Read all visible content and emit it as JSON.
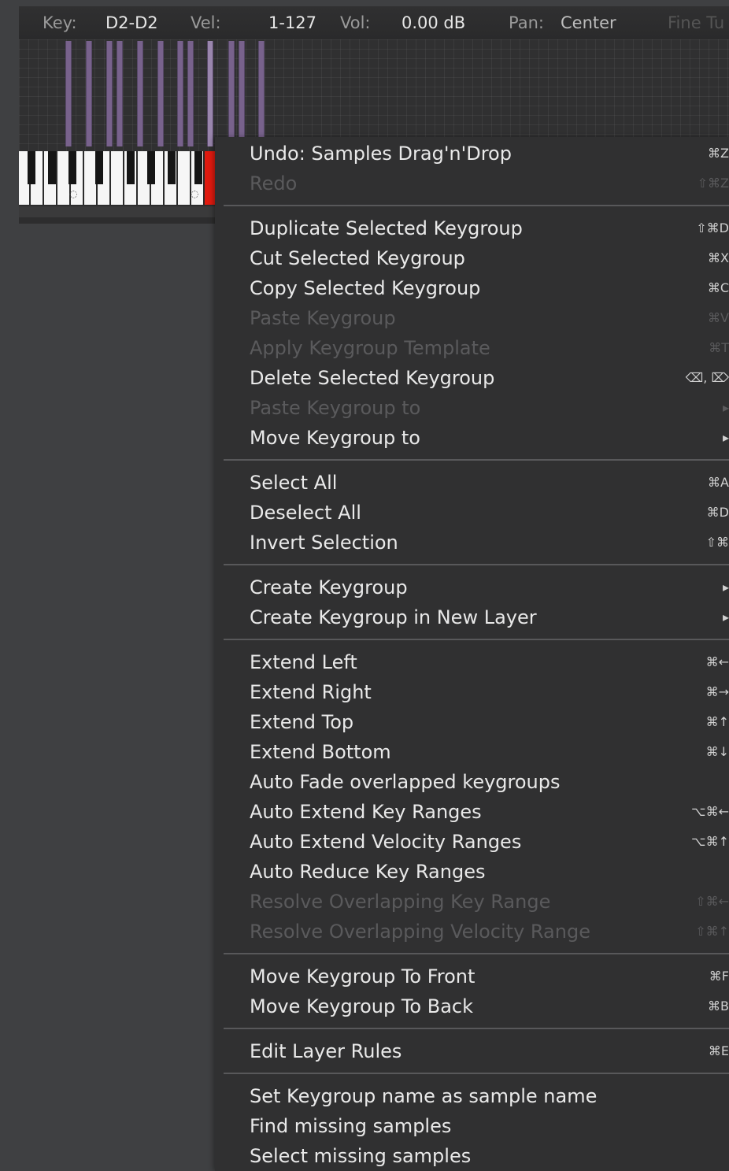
{
  "infobar": {
    "key_label": "Key:",
    "key_value": "D2-D2",
    "vel_label": "Vel:",
    "vel_value": "1-127",
    "vol_label": "Vol:",
    "vol_value": "0.00 dB",
    "pan_label": "Pan:",
    "pan_value": "Center",
    "fine_tune_label": "Fine Tu"
  },
  "menu": {
    "groups": [
      [
        {
          "label": "Undo: Samples Drag'n'Drop",
          "shortcut": "⌘Z",
          "enabled": true
        },
        {
          "label": "Redo",
          "shortcut": "⇧⌘Z",
          "enabled": false
        }
      ],
      [
        {
          "label": "Duplicate Selected Keygroup",
          "shortcut": "⇧⌘D",
          "enabled": true
        },
        {
          "label": "Cut Selected Keygroup",
          "shortcut": "⌘X",
          "enabled": true
        },
        {
          "label": "Copy Selected Keygroup",
          "shortcut": "⌘C",
          "enabled": true
        },
        {
          "label": "Paste Keygroup",
          "shortcut": "⌘V",
          "enabled": false
        },
        {
          "label": "Apply Keygroup Template",
          "shortcut": "⌘T",
          "enabled": false
        },
        {
          "label": "Delete Selected Keygroup",
          "shortcut": "⌫, ⌦",
          "enabled": true
        },
        {
          "label": "Paste Keygroup to",
          "shortcut": "▸",
          "enabled": false
        },
        {
          "label": "Move Keygroup to",
          "shortcut": "▸",
          "enabled": true
        }
      ],
      [
        {
          "label": "Select All",
          "shortcut": "⌘A",
          "enabled": true
        },
        {
          "label": "Deselect All",
          "shortcut": "⌘D",
          "enabled": true
        },
        {
          "label": "Invert Selection",
          "shortcut": "⇧⌘",
          "enabled": true
        }
      ],
      [
        {
          "label": "Create Keygroup",
          "shortcut": "▸",
          "enabled": true
        },
        {
          "label": "Create Keygroup in New Layer",
          "shortcut": "▸",
          "enabled": true
        }
      ],
      [
        {
          "label": "Extend Left",
          "shortcut": "⌘←",
          "enabled": true
        },
        {
          "label": "Extend Right",
          "shortcut": "⌘→",
          "enabled": true
        },
        {
          "label": "Extend Top",
          "shortcut": "⌘↑",
          "enabled": true
        },
        {
          "label": "Extend Bottom",
          "shortcut": "⌘↓",
          "enabled": true
        },
        {
          "label": "Auto Fade overlapped keygroups",
          "shortcut": "",
          "enabled": true
        },
        {
          "label": "Auto Extend Key Ranges",
          "shortcut": "⌥⌘←",
          "enabled": true
        },
        {
          "label": "Auto Extend Velocity Ranges",
          "shortcut": "⌥⌘↑",
          "enabled": true
        },
        {
          "label": "Auto Reduce Key Ranges",
          "shortcut": "",
          "enabled": true
        },
        {
          "label": "Resolve Overlapping Key Range",
          "shortcut": "⇧⌘←",
          "enabled": false
        },
        {
          "label": "Resolve Overlapping Velocity Range",
          "shortcut": "⇧⌘↑",
          "enabled": false
        }
      ],
      [
        {
          "label": "Move Keygroup To Front",
          "shortcut": "⌘F",
          "enabled": true
        },
        {
          "label": "Move Keygroup To Back",
          "shortcut": "⌘B",
          "enabled": true
        }
      ],
      [
        {
          "label": "Edit Layer Rules",
          "shortcut": "⌘E",
          "enabled": true
        }
      ],
      [
        {
          "label": "Set Keygroup name as sample name",
          "shortcut": "",
          "enabled": true
        },
        {
          "label": "Find missing samples",
          "shortcut": "",
          "enabled": true
        },
        {
          "label": "Select missing samples",
          "shortcut": "",
          "enabled": true
        }
      ]
    ]
  }
}
